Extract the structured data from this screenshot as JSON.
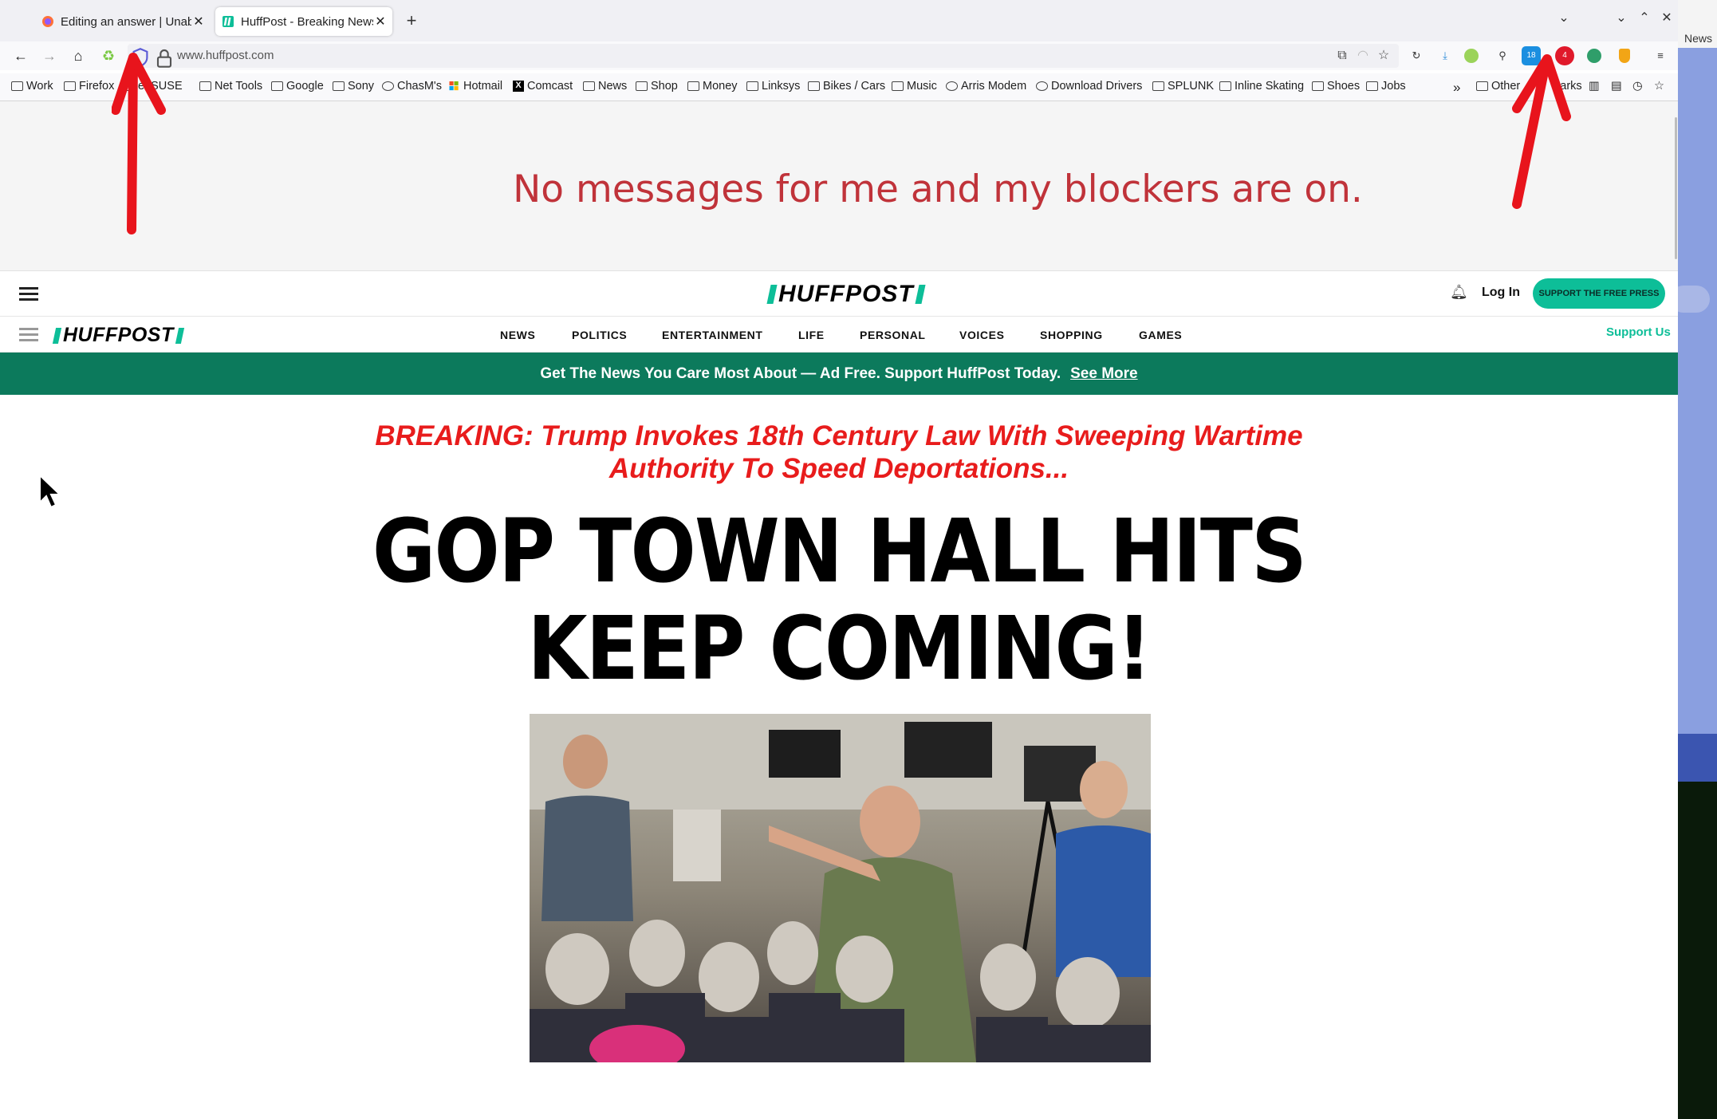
{
  "browser": {
    "tabs": [
      {
        "title": "Editing an answer | Unabl",
        "active": false
      },
      {
        "title": "HuffPost - Breaking News,",
        "active": true
      }
    ],
    "url": "www.huffpost.com",
    "extension_badges": {
      "ext_a": "18",
      "ext_b": "4"
    },
    "bookmarks": [
      {
        "label": "Work",
        "icon": "folder-icon"
      },
      {
        "label": "Firefox",
        "icon": "folder-icon"
      },
      {
        "label": "enSUSE",
        "icon": "folder-icon"
      },
      {
        "label": "Net Tools",
        "icon": "folder-icon"
      },
      {
        "label": "Google",
        "icon": "folder-icon"
      },
      {
        "label": "Sony",
        "icon": "folder-icon"
      },
      {
        "label": "ChasM's",
        "icon": "globe-icon"
      },
      {
        "label": "Hotmail",
        "icon": "microsoft-icon"
      },
      {
        "label": "Comcast",
        "icon": "x-icon"
      },
      {
        "label": "News",
        "icon": "folder-icon"
      },
      {
        "label": "Shop",
        "icon": "folder-icon"
      },
      {
        "label": "Money",
        "icon": "folder-icon"
      },
      {
        "label": "Linksys",
        "icon": "folder-icon"
      },
      {
        "label": "Bikes / Cars",
        "icon": "folder-icon"
      },
      {
        "label": "Music",
        "icon": "folder-icon"
      },
      {
        "label": "Arris Modem",
        "icon": "globe-icon"
      },
      {
        "label": "Download Drivers",
        "icon": "globe-icon"
      },
      {
        "label": "SPLUNK",
        "icon": "folder-icon"
      },
      {
        "label": "Inline Skating",
        "icon": "folder-icon"
      },
      {
        "label": "Shoes",
        "icon": "folder-icon"
      },
      {
        "label": "Jobs",
        "icon": "folder-icon"
      }
    ],
    "other_bookmarks_left": "Other",
    "other_bookmarks_right": "arks"
  },
  "desktop": {
    "label": "News"
  },
  "annotation": {
    "message": "No messages for me and my blockers are on."
  },
  "huffpost": {
    "logo": "HUFFPOST",
    "login": "Log In",
    "support_button": "SUPPORT THE FREE PRESS",
    "sections": [
      "NEWS",
      "POLITICS",
      "ENTERTAINMENT",
      "LIFE",
      "PERSONAL",
      "VOICES",
      "SHOPPING",
      "GAMES"
    ],
    "support_us": "Support Us",
    "promo_text": "Get The News You Care Most About — Ad Free. Support HuffPost Today.",
    "promo_link": "See More",
    "breaking_line1": "BREAKING: Trump Invokes 18th Century Law With Sweeping Wartime",
    "breaking_line2": "Authority To Speed Deportations...",
    "headline_line1": "GOP TOWN HALL HITS",
    "headline_line2": "KEEP COMING!"
  },
  "colors": {
    "brand": "#0dbe98",
    "promo_bg": "#0c7a5c",
    "breaking": "#e81c1c",
    "annotation": "#c0333a",
    "arrow": "#e8141c"
  }
}
